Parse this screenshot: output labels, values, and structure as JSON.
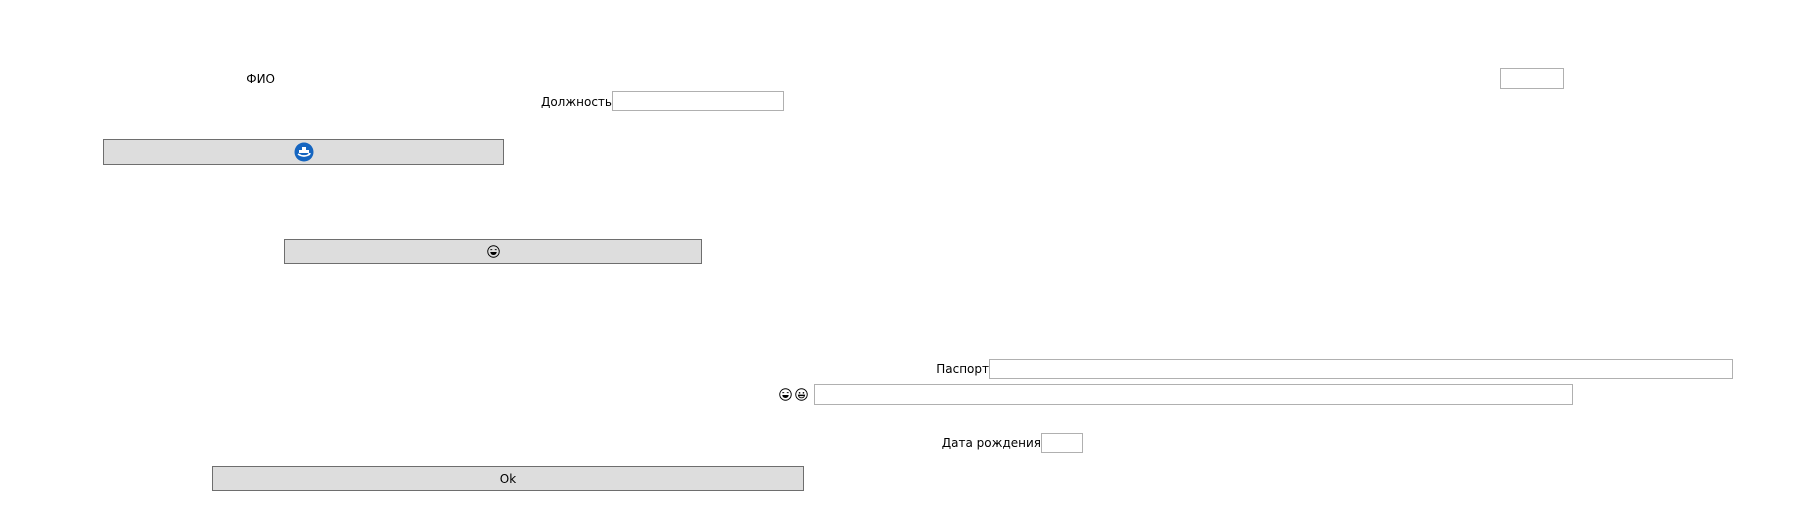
{
  "fields": {
    "fio_label": "ФИО",
    "fio_value": "",
    "position_label": "Должность",
    "position_value": "",
    "passport_label": "Паспорт",
    "passport_value": "",
    "emoji_field_value": "",
    "birthdate_label": "Дата рождения",
    "birthdate_value": ""
  },
  "buttons": {
    "ok_label": "Ok",
    "icon_button_1_icon": "ship-badge-icon",
    "icon_button_2_icon": "laughing-face-icon"
  },
  "emoji_label_icons": [
    "laughing-face-icon",
    "grinning-face-icon"
  ],
  "colors": {
    "button_bg": "#dddddd",
    "button_border": "#6e6e6e",
    "field_border": "#b0b0b0",
    "icon_blue": "#1565c0"
  }
}
